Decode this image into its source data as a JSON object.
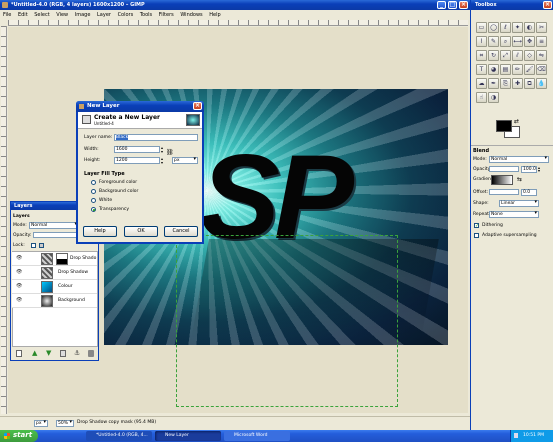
{
  "gimp": {
    "title": "*Untitled-4.0 (RGB, 4 layers) 1600x1200 – GIMP",
    "menu": [
      "File",
      "Edit",
      "Select",
      "View",
      "Image",
      "Layer",
      "Colors",
      "Tools",
      "Filters",
      "Windows",
      "Help"
    ],
    "status_unit": "px",
    "status_zoom": "50%",
    "status_text": "Drop Shadow copy mask (95.4 MB)"
  },
  "artwork": {
    "text": "SP"
  },
  "layers_panel": {
    "title": "Layers",
    "mode_label": "Mode:",
    "mode_value": "Normal",
    "opacity_label": "Opacity:",
    "lock_label": "Lock:",
    "layers": [
      {
        "name": "Drop Shado"
      },
      {
        "name": "Drop Shadow"
      },
      {
        "name": "Colour"
      },
      {
        "name": "Background"
      }
    ]
  },
  "dialog": {
    "title": "New Layer",
    "heading": "Create a New Layer",
    "subheading": "Untitled-4",
    "layer_name_label": "Layer name:",
    "layer_name_value": "Black",
    "width_label": "Width:",
    "width_value": "1600",
    "height_label": "Height:",
    "height_value": "1200",
    "unit": "px",
    "fill_heading": "Layer Fill Type",
    "fill_options": [
      "Foreground color",
      "Background color",
      "White",
      "Transparency"
    ],
    "fill_selected": "Transparency",
    "help_label": "Help",
    "ok_label": "OK",
    "cancel_label": "Cancel"
  },
  "toolbox": {
    "title": "Toolbox",
    "tool_icons": [
      "rect-select",
      "ellipse-select",
      "lasso",
      "fuzzy-select",
      "color-select",
      "scissors",
      "paths",
      "color-picker",
      "zoom",
      "measure",
      "move",
      "align",
      "crop",
      "rotate",
      "scale",
      "shear",
      "perspective",
      "flip",
      "text",
      "bucket-fill",
      "blend",
      "pencil",
      "paintbrush",
      "eraser",
      "airbrush",
      "ink",
      "clone",
      "heal",
      "perspective-clone",
      "blur",
      "smudge",
      "dodge-burn"
    ],
    "blend": {
      "heading": "Blend",
      "mode_label": "Mode:",
      "mode_value": "Normal",
      "opacity_label": "Opacity:",
      "opacity_value": "100.0",
      "gradient_label": "Gradient:",
      "offset_label": "Offset:",
      "offset_value": "0.0",
      "shape_label": "Shape:",
      "shape_value": "Linear",
      "repeat_label": "Repeat:",
      "repeat_value": "None",
      "dithering_label": "Dithering",
      "adaptive_label": "Adaptive supersampling"
    }
  },
  "taskbar": {
    "start_label": "start",
    "items": [
      "*Untitled-4.0 (RGB, 4...",
      "New Layer",
      "Microsoft Word"
    ],
    "clock": "10:51 PM"
  },
  "colors": {
    "xp_blue": "#245edb",
    "start_green": "#3c9a3c",
    "artwork_glow": "#3fe0d6",
    "canvas_bg": "#e4dfc9"
  }
}
